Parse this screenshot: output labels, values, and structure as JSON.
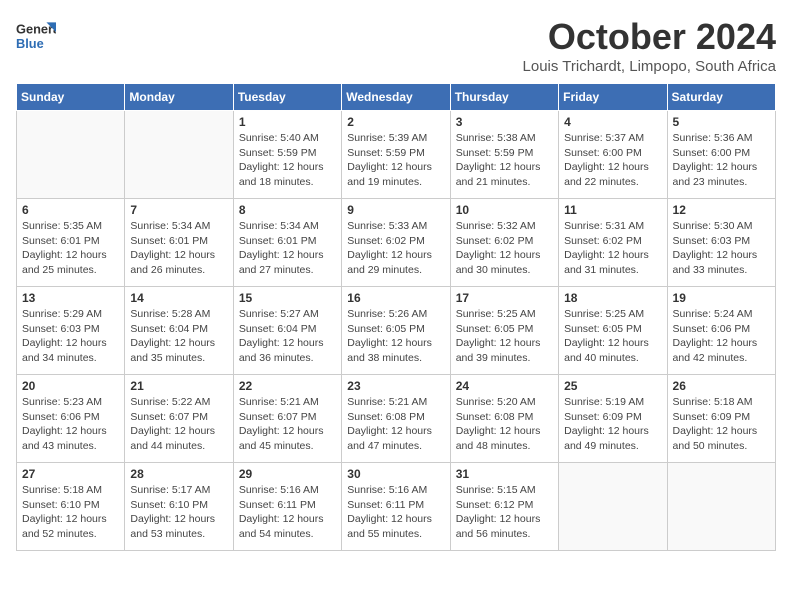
{
  "header": {
    "title": "October 2024",
    "subtitle": "Louis Trichardt, Limpopo, South Africa",
    "logo_line1": "General",
    "logo_line2": "Blue"
  },
  "days_of_week": [
    "Sunday",
    "Monday",
    "Tuesday",
    "Wednesday",
    "Thursday",
    "Friday",
    "Saturday"
  ],
  "weeks": [
    [
      {
        "day": "",
        "info": ""
      },
      {
        "day": "",
        "info": ""
      },
      {
        "day": "1",
        "sunrise": "5:40 AM",
        "sunset": "5:59 PM",
        "daylight": "12 hours and 18 minutes."
      },
      {
        "day": "2",
        "sunrise": "5:39 AM",
        "sunset": "5:59 PM",
        "daylight": "12 hours and 19 minutes."
      },
      {
        "day": "3",
        "sunrise": "5:38 AM",
        "sunset": "5:59 PM",
        "daylight": "12 hours and 21 minutes."
      },
      {
        "day": "4",
        "sunrise": "5:37 AM",
        "sunset": "6:00 PM",
        "daylight": "12 hours and 22 minutes."
      },
      {
        "day": "5",
        "sunrise": "5:36 AM",
        "sunset": "6:00 PM",
        "daylight": "12 hours and 23 minutes."
      }
    ],
    [
      {
        "day": "6",
        "sunrise": "5:35 AM",
        "sunset": "6:01 PM",
        "daylight": "12 hours and 25 minutes."
      },
      {
        "day": "7",
        "sunrise": "5:34 AM",
        "sunset": "6:01 PM",
        "daylight": "12 hours and 26 minutes."
      },
      {
        "day": "8",
        "sunrise": "5:34 AM",
        "sunset": "6:01 PM",
        "daylight": "12 hours and 27 minutes."
      },
      {
        "day": "9",
        "sunrise": "5:33 AM",
        "sunset": "6:02 PM",
        "daylight": "12 hours and 29 minutes."
      },
      {
        "day": "10",
        "sunrise": "5:32 AM",
        "sunset": "6:02 PM",
        "daylight": "12 hours and 30 minutes."
      },
      {
        "day": "11",
        "sunrise": "5:31 AM",
        "sunset": "6:02 PM",
        "daylight": "12 hours and 31 minutes."
      },
      {
        "day": "12",
        "sunrise": "5:30 AM",
        "sunset": "6:03 PM",
        "daylight": "12 hours and 33 minutes."
      }
    ],
    [
      {
        "day": "13",
        "sunrise": "5:29 AM",
        "sunset": "6:03 PM",
        "daylight": "12 hours and 34 minutes."
      },
      {
        "day": "14",
        "sunrise": "5:28 AM",
        "sunset": "6:04 PM",
        "daylight": "12 hours and 35 minutes."
      },
      {
        "day": "15",
        "sunrise": "5:27 AM",
        "sunset": "6:04 PM",
        "daylight": "12 hours and 36 minutes."
      },
      {
        "day": "16",
        "sunrise": "5:26 AM",
        "sunset": "6:05 PM",
        "daylight": "12 hours and 38 minutes."
      },
      {
        "day": "17",
        "sunrise": "5:25 AM",
        "sunset": "6:05 PM",
        "daylight": "12 hours and 39 minutes."
      },
      {
        "day": "18",
        "sunrise": "5:25 AM",
        "sunset": "6:05 PM",
        "daylight": "12 hours and 40 minutes."
      },
      {
        "day": "19",
        "sunrise": "5:24 AM",
        "sunset": "6:06 PM",
        "daylight": "12 hours and 42 minutes."
      }
    ],
    [
      {
        "day": "20",
        "sunrise": "5:23 AM",
        "sunset": "6:06 PM",
        "daylight": "12 hours and 43 minutes."
      },
      {
        "day": "21",
        "sunrise": "5:22 AM",
        "sunset": "6:07 PM",
        "daylight": "12 hours and 44 minutes."
      },
      {
        "day": "22",
        "sunrise": "5:21 AM",
        "sunset": "6:07 PM",
        "daylight": "12 hours and 45 minutes."
      },
      {
        "day": "23",
        "sunrise": "5:21 AM",
        "sunset": "6:08 PM",
        "daylight": "12 hours and 47 minutes."
      },
      {
        "day": "24",
        "sunrise": "5:20 AM",
        "sunset": "6:08 PM",
        "daylight": "12 hours and 48 minutes."
      },
      {
        "day": "25",
        "sunrise": "5:19 AM",
        "sunset": "6:09 PM",
        "daylight": "12 hours and 49 minutes."
      },
      {
        "day": "26",
        "sunrise": "5:18 AM",
        "sunset": "6:09 PM",
        "daylight": "12 hours and 50 minutes."
      }
    ],
    [
      {
        "day": "27",
        "sunrise": "5:18 AM",
        "sunset": "6:10 PM",
        "daylight": "12 hours and 52 minutes."
      },
      {
        "day": "28",
        "sunrise": "5:17 AM",
        "sunset": "6:10 PM",
        "daylight": "12 hours and 53 minutes."
      },
      {
        "day": "29",
        "sunrise": "5:16 AM",
        "sunset": "6:11 PM",
        "daylight": "12 hours and 54 minutes."
      },
      {
        "day": "30",
        "sunrise": "5:16 AM",
        "sunset": "6:11 PM",
        "daylight": "12 hours and 55 minutes."
      },
      {
        "day": "31",
        "sunrise": "5:15 AM",
        "sunset": "6:12 PM",
        "daylight": "12 hours and 56 minutes."
      },
      {
        "day": "",
        "info": ""
      },
      {
        "day": "",
        "info": ""
      }
    ]
  ]
}
